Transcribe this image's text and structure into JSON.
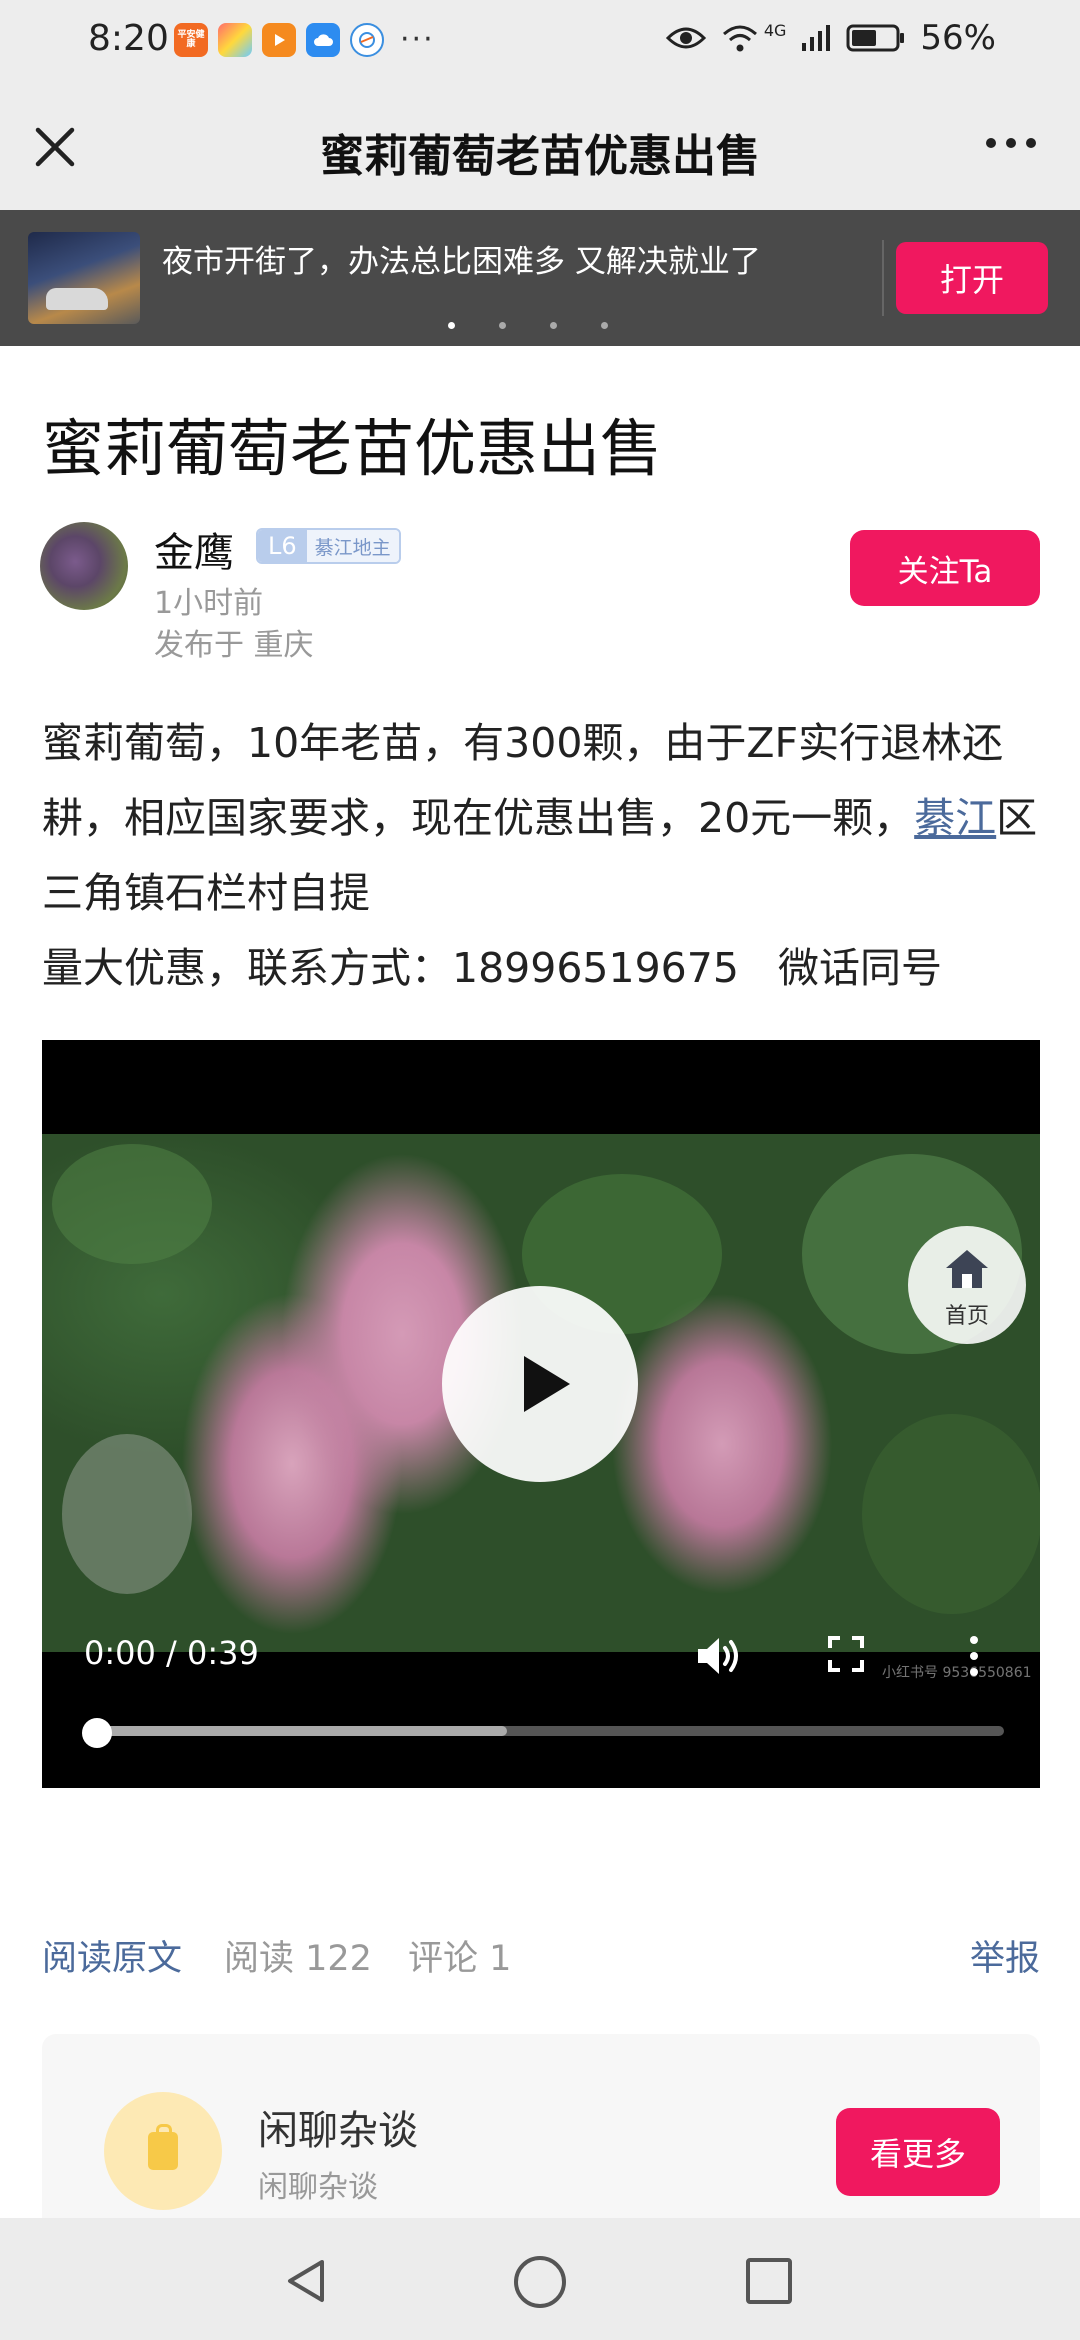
{
  "status_bar": {
    "time": "8:20",
    "more": "···",
    "network": "4G",
    "battery": "56%",
    "apps": [
      {
        "icon": "health-app-icon",
        "label": "平安健康",
        "color": "#f26a22"
      },
      {
        "icon": "colorful-app-icon",
        "label": "",
        "color": "#e8506e"
      },
      {
        "icon": "video-app-icon",
        "label": "",
        "color": "#f58a1f"
      },
      {
        "icon": "cloud-app-icon",
        "label": "",
        "color": "#2d8cf0"
      },
      {
        "icon": "browser-app-icon",
        "label": "",
        "color": "#3b8fe0"
      }
    ]
  },
  "nav": {
    "title": "蜜莉葡萄老苗优惠出售",
    "close_icon": "close-icon",
    "more_icon": "more-icon"
  },
  "banner": {
    "text": "夜市开街了，办法总比困难多 又解决就业了",
    "open_label": "打开",
    "page_count": 4,
    "active_page": 1
  },
  "article": {
    "title": "蜜莉葡萄老苗优惠出售",
    "author": {
      "name": "金鹰",
      "level": "L6",
      "level_title": "綦江地主",
      "time": "1小时前",
      "location": "发布于 重庆"
    },
    "follow_label": "关注Ta",
    "body": {
      "part1": "蜜莉葡萄，10年老苗，有300颗，由于ZF实行退林还耕，相应国家要求，现在优惠出售，20元一颗，",
      "link": "綦江",
      "part2": "区三角镇石栏村自提",
      "line2": "量大优惠，联系方式：18996519675   微话同号"
    }
  },
  "video": {
    "time_display": "0:00 / 0:39",
    "buffered_fraction": 0.45,
    "played_fraction": 0.0,
    "home_label": "首页",
    "watermark": "小红书号 9536550861"
  },
  "stats": {
    "read_original": "阅读原文",
    "reads": "阅读 122",
    "comments": "评论 1",
    "report": "举报"
  },
  "circle": {
    "name": "闲聊杂谈",
    "subtitle": "闲聊杂谈",
    "more_label": "看更多"
  },
  "colors": {
    "accent": "#f0185f",
    "link": "#4b6a9b",
    "header_bg": "#ededed",
    "banner_bg": "#4a4a4a"
  }
}
